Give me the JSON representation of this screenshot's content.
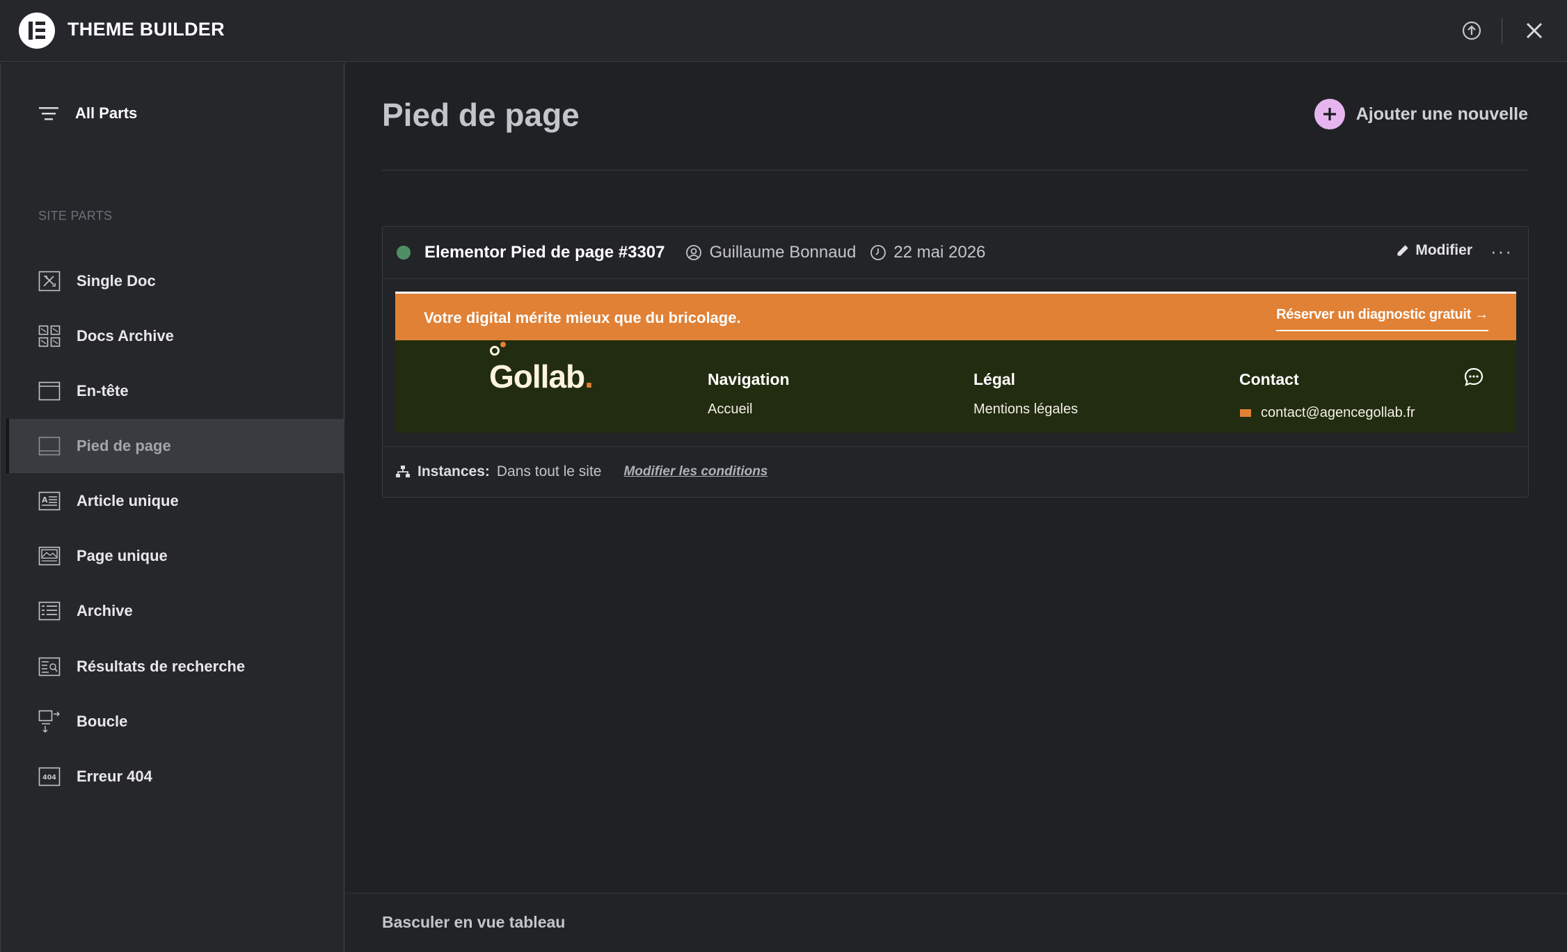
{
  "app": {
    "title": "THEME BUILDER"
  },
  "sidebar": {
    "all_parts_label": "All Parts",
    "section_heading": "SITE PARTS",
    "items": [
      {
        "label": "Single Doc",
        "icon": "single-doc-icon"
      },
      {
        "label": "Docs Archive",
        "icon": "docs-archive-icon"
      },
      {
        "label": "En-tête",
        "icon": "header-icon"
      },
      {
        "label": "Pied de page",
        "icon": "footer-icon",
        "active": true
      },
      {
        "label": "Article unique",
        "icon": "single-post-icon"
      },
      {
        "label": "Page unique",
        "icon": "single-page-icon"
      },
      {
        "label": "Archive",
        "icon": "archive-icon"
      },
      {
        "label": "Résultats de recherche",
        "icon": "search-results-icon"
      },
      {
        "label": "Boucle",
        "icon": "loop-icon"
      },
      {
        "label": "Erreur 404",
        "icon": "error-404-icon"
      }
    ]
  },
  "main": {
    "page_title": "Pied de page",
    "add_new_label": "Ajouter une nouvelle",
    "template_card": {
      "title": "Elementor Pied de page #3307",
      "author": "Guillaume Bonnaud",
      "date": "22 mai 2026",
      "edit_label": "Modifier",
      "more_label": "···",
      "status_color": "#4f8f66",
      "instances_label": "Instances:",
      "instances_value": "Dans tout le site",
      "conditions_link": "Modifier les conditions",
      "preview": {
        "promo_text": "Votre digital mérite mieux que du bricolage.",
        "promo_cta": "Réserver un diagnostic gratuit →",
        "brand": "Gollab",
        "brand_dot": ".",
        "columns": [
          {
            "heading": "Navigation",
            "first_link": "Accueil"
          },
          {
            "heading": "Légal",
            "first_link": "Mentions légales"
          },
          {
            "heading": "Contact",
            "first_link": "contact@agencegollab.fr"
          }
        ],
        "colors": {
          "promo": "#e08136",
          "footer_bg": "#222c10",
          "accent": "#e08136"
        }
      }
    },
    "bottom_toggle": "Basculer en vue tableau"
  },
  "colors": {
    "add_button": "#e6b5f0",
    "background": "#202124",
    "panel": "#26272b"
  }
}
